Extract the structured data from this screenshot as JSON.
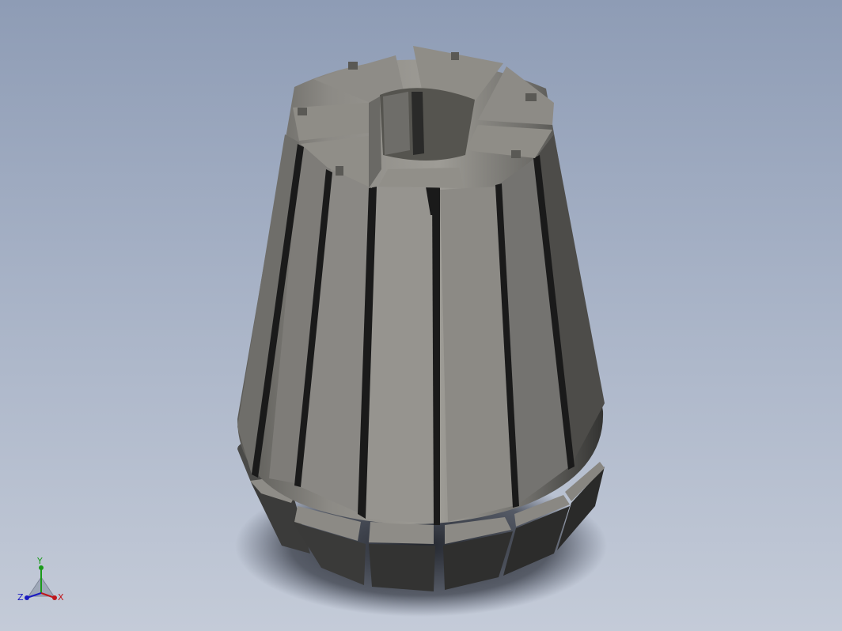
{
  "viewport": {
    "background_top": "#8e9cb5",
    "background_bottom": "#c4cbd8"
  },
  "model": {
    "part": "collet",
    "face_color": "#9b9993",
    "top_face_color": "#8f8d87",
    "dark_side_color": "#2e2e2e"
  },
  "triad": {
    "x_label": "X",
    "y_label": "Y",
    "z_label": "Z",
    "x_color": "#c0161a",
    "y_color": "#1a9a1a",
    "z_color": "#1a1ac0"
  }
}
